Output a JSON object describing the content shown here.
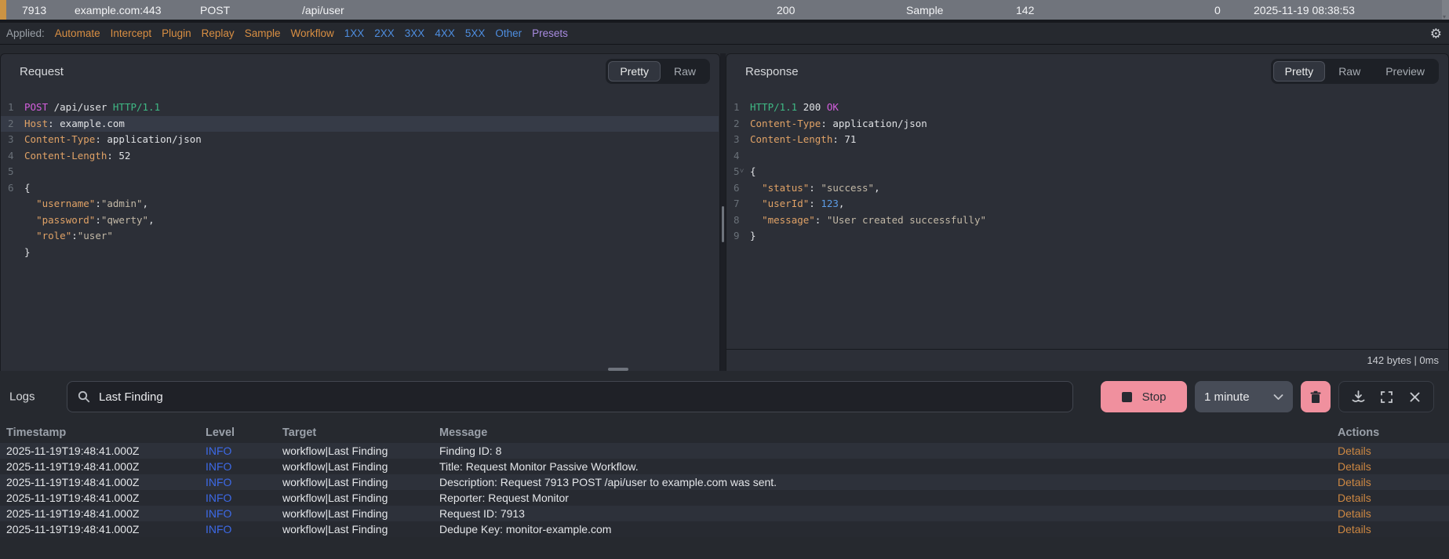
{
  "top_row": {
    "id": "7913",
    "host": "example.com:443",
    "method": "POST",
    "path": "/api/user",
    "status": "200",
    "source": "Sample",
    "length": "142",
    "extra": "0",
    "timestamp": "2025-11-19 08:38:53"
  },
  "filter_bar": {
    "label": "Applied:",
    "workflow_filters": [
      "Automate",
      "Intercept",
      "Plugin",
      "Replay",
      "Sample",
      "Workflow"
    ],
    "status_filters": [
      "1XX",
      "2XX",
      "3XX",
      "4XX",
      "5XX",
      "Other"
    ],
    "preset_filter": "Presets"
  },
  "request_panel": {
    "title": "Request",
    "tabs": [
      {
        "label": "Pretty",
        "active": true
      },
      {
        "label": "Raw",
        "active": false
      }
    ],
    "lines": [
      {
        "num": "1",
        "tokens": [
          [
            "method",
            "POST"
          ],
          [
            "plain",
            " /api/user "
          ],
          [
            "version",
            "HTTP/1.1"
          ]
        ]
      },
      {
        "num": "2",
        "highlight": true,
        "tokens": [
          [
            "key",
            "Host"
          ],
          [
            "plain",
            ": example.com"
          ]
        ]
      },
      {
        "num": "3",
        "tokens": [
          [
            "key",
            "Content-Type"
          ],
          [
            "plain",
            ": application/json"
          ]
        ]
      },
      {
        "num": "4",
        "tokens": [
          [
            "key",
            "Content-Length"
          ],
          [
            "plain",
            ": 52"
          ]
        ]
      },
      {
        "num": "5",
        "tokens": []
      },
      {
        "num": "6",
        "tokens": [
          [
            "plain",
            "{"
          ]
        ]
      },
      {
        "num": "",
        "tokens": [
          [
            "plain",
            "  "
          ],
          [
            "key",
            "\"username\""
          ],
          [
            "plain",
            ":"
          ],
          [
            "str",
            "\"admin\""
          ],
          [
            "plain",
            ","
          ]
        ]
      },
      {
        "num": "",
        "tokens": [
          [
            "plain",
            "  "
          ],
          [
            "key",
            "\"password\""
          ],
          [
            "plain",
            ":"
          ],
          [
            "str",
            "\"qwerty\""
          ],
          [
            "plain",
            ","
          ]
        ]
      },
      {
        "num": "",
        "tokens": [
          [
            "plain",
            "  "
          ],
          [
            "key",
            "\"role\""
          ],
          [
            "plain",
            ":"
          ],
          [
            "str",
            "\"user\""
          ]
        ]
      },
      {
        "num": "",
        "tokens": [
          [
            "plain",
            "}"
          ]
        ]
      }
    ]
  },
  "response_panel": {
    "title": "Response",
    "tabs": [
      {
        "label": "Pretty",
        "active": true
      },
      {
        "label": "Raw",
        "active": false
      },
      {
        "label": "Preview",
        "active": false
      }
    ],
    "lines": [
      {
        "num": "1",
        "tokens": [
          [
            "version",
            "HTTP/1.1"
          ],
          [
            "plain",
            " 200 "
          ],
          [
            "method",
            "OK"
          ]
        ]
      },
      {
        "num": "2",
        "tokens": [
          [
            "key",
            "Content-Type"
          ],
          [
            "plain",
            ": application/json"
          ]
        ]
      },
      {
        "num": "3",
        "tokens": [
          [
            "key",
            "Content-Length"
          ],
          [
            "plain",
            ": 71"
          ]
        ]
      },
      {
        "num": "4",
        "tokens": []
      },
      {
        "num": "5",
        "fold": true,
        "tokens": [
          [
            "plain",
            "{"
          ]
        ]
      },
      {
        "num": "6",
        "tokens": [
          [
            "plain",
            "  "
          ],
          [
            "key",
            "\"status\""
          ],
          [
            "plain",
            ": "
          ],
          [
            "str",
            "\"success\""
          ],
          [
            "plain",
            ","
          ]
        ]
      },
      {
        "num": "7",
        "tokens": [
          [
            "plain",
            "  "
          ],
          [
            "key",
            "\"userId\""
          ],
          [
            "plain",
            ": "
          ],
          [
            "num",
            "123"
          ],
          [
            "plain",
            ","
          ]
        ]
      },
      {
        "num": "8",
        "tokens": [
          [
            "plain",
            "  "
          ],
          [
            "key",
            "\"message\""
          ],
          [
            "plain",
            ": "
          ],
          [
            "str",
            "\"User created successfully\""
          ]
        ]
      },
      {
        "num": "9",
        "tokens": [
          [
            "plain",
            "}"
          ]
        ]
      }
    ],
    "footer": "142 bytes  |  0ms"
  },
  "logs": {
    "title": "Logs",
    "search_value": "Last Finding",
    "stop_button": "Stop",
    "interval_select": "1 minute",
    "table": {
      "headers": [
        "Timestamp",
        "Level",
        "Target",
        "Message",
        "Actions"
      ],
      "rows": [
        {
          "timestamp": "2025-11-19T19:48:41.000Z",
          "level": "INFO",
          "target": "workflow|Last Finding",
          "message": "Finding ID: 8",
          "action": "Details"
        },
        {
          "timestamp": "2025-11-19T19:48:41.000Z",
          "level": "INFO",
          "target": "workflow|Last Finding",
          "message": "Title: Request Monitor Passive Workflow.",
          "action": "Details"
        },
        {
          "timestamp": "2025-11-19T19:48:41.000Z",
          "level": "INFO",
          "target": "workflow|Last Finding",
          "message": "Description: Request 7913 POST /api/user to example.com was sent.",
          "action": "Details"
        },
        {
          "timestamp": "2025-11-19T19:48:41.000Z",
          "level": "INFO",
          "target": "workflow|Last Finding",
          "message": "Reporter: Request Monitor",
          "action": "Details"
        },
        {
          "timestamp": "2025-11-19T19:48:41.000Z",
          "level": "INFO",
          "target": "workflow|Last Finding",
          "message": "Request ID: 7913",
          "action": "Details"
        },
        {
          "timestamp": "2025-11-19T19:48:41.000Z",
          "level": "INFO",
          "target": "workflow|Last Finding",
          "message": "Dedupe Key: monitor-example.com",
          "action": "Details"
        }
      ]
    }
  },
  "icons": {
    "gear": "gear-icon",
    "search": "search-icon",
    "stop": "stop-icon",
    "chevron_down": "chevron-down-icon",
    "trash": "trash-icon",
    "download": "download-icon",
    "fullscreen": "fullscreen-icon",
    "close": "close-icon",
    "fold": "fold-chevron-icon"
  },
  "colors": {
    "selected_row_bg": "#70747c",
    "selected_row_accent": "#cb9343",
    "filter_orange": "#d98f43",
    "filter_blue": "#4e8ee0",
    "filter_purple": "#a88be0",
    "syntax_method": "#d55fde",
    "syntax_version": "#3fba85",
    "syntax_key": "#e0a266",
    "syntax_string": "#c2b8a6",
    "syntax_number": "#5c9ce6",
    "info_level": "#3d6ae8",
    "details_link": "#cc8742",
    "stop_button_bg": "#f0909e"
  }
}
